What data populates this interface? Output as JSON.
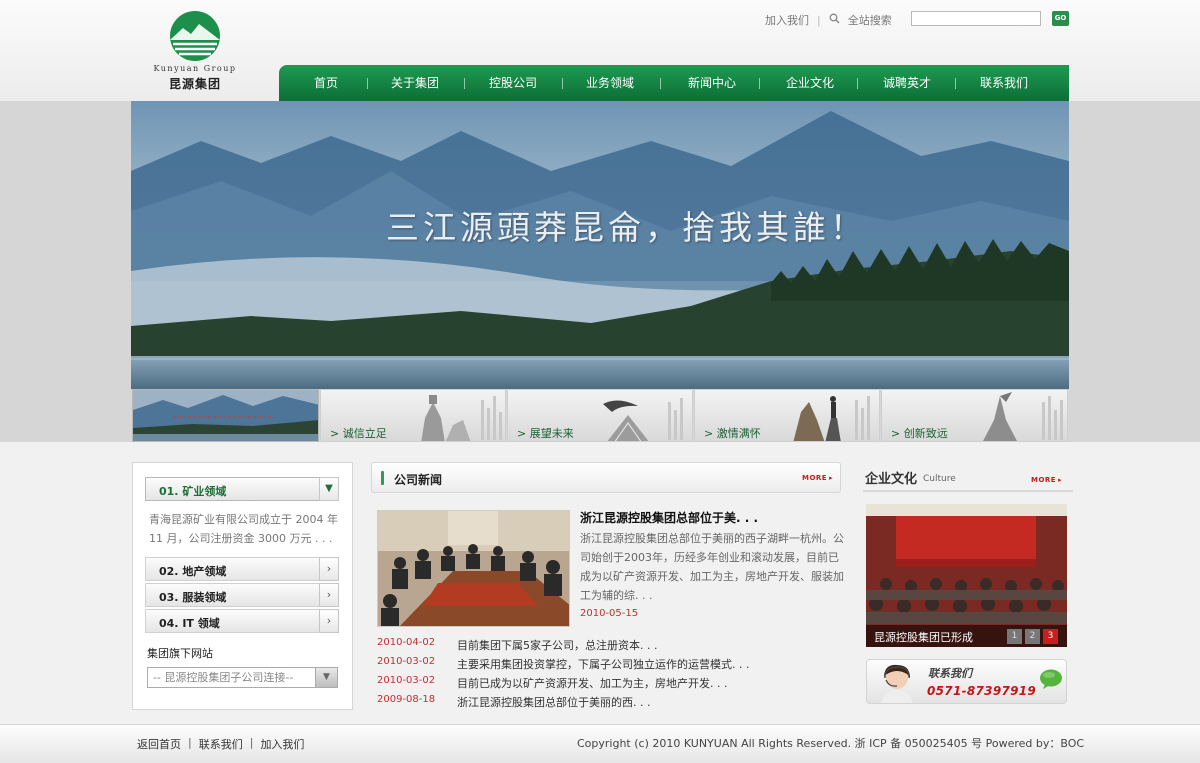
{
  "header": {
    "logo": {
      "en": "Kunyuan Group",
      "cn": "昆源集团"
    },
    "links": [
      "加入我们",
      "全站搜索"
    ],
    "search": {
      "placeholder": "",
      "go_label": "GO"
    }
  },
  "nav": {
    "items": [
      "首页",
      "关于集团",
      "控股公司",
      "业务领域",
      "新闻中心",
      "企业文化",
      "诚聘英才",
      "联系我们"
    ]
  },
  "hero": {
    "slogan": "三江源頭莽昆侖，捨我其誰！"
  },
  "thumbs": {
    "items": [
      "> 诚信立足",
      "> 展望未来",
      "> 激情满怀",
      "> 创新致远"
    ]
  },
  "sidebar": {
    "categories": [
      {
        "label": "01.  矿业领域",
        "active": true
      },
      {
        "label": "02.  地产领域",
        "active": false
      },
      {
        "label": "03.  服装领域",
        "active": false
      },
      {
        "label": "04.  IT 领域",
        "active": false
      }
    ],
    "description": "青海昆源矿业有限公司成立于 2004 年 11 月，公司注册资金 3000 万元 . . .",
    "sites_label": "集团旗下网站",
    "sites_select": "-- 昆源控股集团子公司连接--"
  },
  "news": {
    "title": "公司新闻",
    "more": "MORE",
    "headline": "浙江昆源控股集团总部位于美. . .",
    "summary": "浙江昆源控股集团总部位于美丽的西子湖畔一杭州。公司始创于2003年，历经多年创业和滚动发展，目前已成为以矿产资源开发、加工为主，房地产开发、服装加工为辅的综. . .",
    "date": "2010-05-15",
    "list": [
      {
        "date": "2010-04-02",
        "title": "目前集团下属5家子公司，总注册资本. . ."
      },
      {
        "date": "2010-03-02",
        "title": "主要采用集团投资掌控，下属子公司独立运作的运营模式. . ."
      },
      {
        "date": "2010-03-02",
        "title": "目前已成为以矿产资源开发、加工为主，房地产开发. . ."
      },
      {
        "date": "2009-08-18",
        "title": "浙江昆源控股集团总部位于美丽的西. . ."
      }
    ]
  },
  "culture": {
    "title": "企业文化",
    "subtitle": "Culture",
    "more": "MORE",
    "caption": "昆源控股集团已形成",
    "pages": [
      "1",
      "2",
      "3"
    ],
    "active_page": "3"
  },
  "contact": {
    "label": "联系我们",
    "phone": "0571-87397919"
  },
  "footer": {
    "links": [
      "返回首页",
      "联系我们",
      "加入我们"
    ],
    "copyright": "Copyright (c) 2010 KUNYUAN All Rights Reserved. 浙 ICP 备 050025405 号  Powered by：BOC"
  },
  "colors": {
    "brand_green": "#137a3e",
    "accent_red": "#c31b1b"
  }
}
